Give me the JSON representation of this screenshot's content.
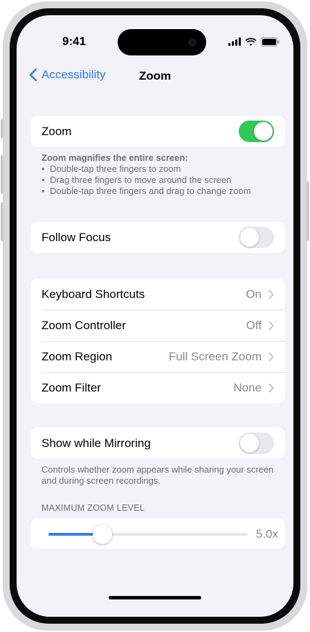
{
  "status": {
    "time": "9:41",
    "icons": [
      "cellular-signal-icon",
      "wifi-icon",
      "battery-icon"
    ]
  },
  "nav": {
    "back_label": "Accessibility",
    "title": "Zoom"
  },
  "zoom_group": {
    "label": "Zoom",
    "toggle_on": true
  },
  "zoom_footer": {
    "heading": "Zoom magnifies the entire screen:",
    "bullets": [
      "Double-tap three fingers to zoom",
      "Drag three fingers to move around the screen",
      "Double-tap three fingers and drag to change zoom"
    ]
  },
  "follow_focus": {
    "label": "Follow Focus",
    "toggle_on": false
  },
  "settings": [
    {
      "label": "Keyboard Shortcuts",
      "value": "On"
    },
    {
      "label": "Zoom Controller",
      "value": "Off"
    },
    {
      "label": "Zoom Region",
      "value": "Full Screen Zoom"
    },
    {
      "label": "Zoom Filter",
      "value": "None"
    }
  ],
  "mirroring": {
    "label": "Show while Mirroring",
    "toggle_on": false,
    "footer": "Controls whether zoom appears while sharing your screen and during screen recordings."
  },
  "max_zoom": {
    "header": "MAXIMUM ZOOM LEVEL",
    "value_label": "5.0x",
    "fraction": 0.27
  },
  "colors": {
    "accent": "#3478f6",
    "toggle_on": "#34c759",
    "toggle_off": "#e9e9eb",
    "background": "#f2f2f7"
  }
}
